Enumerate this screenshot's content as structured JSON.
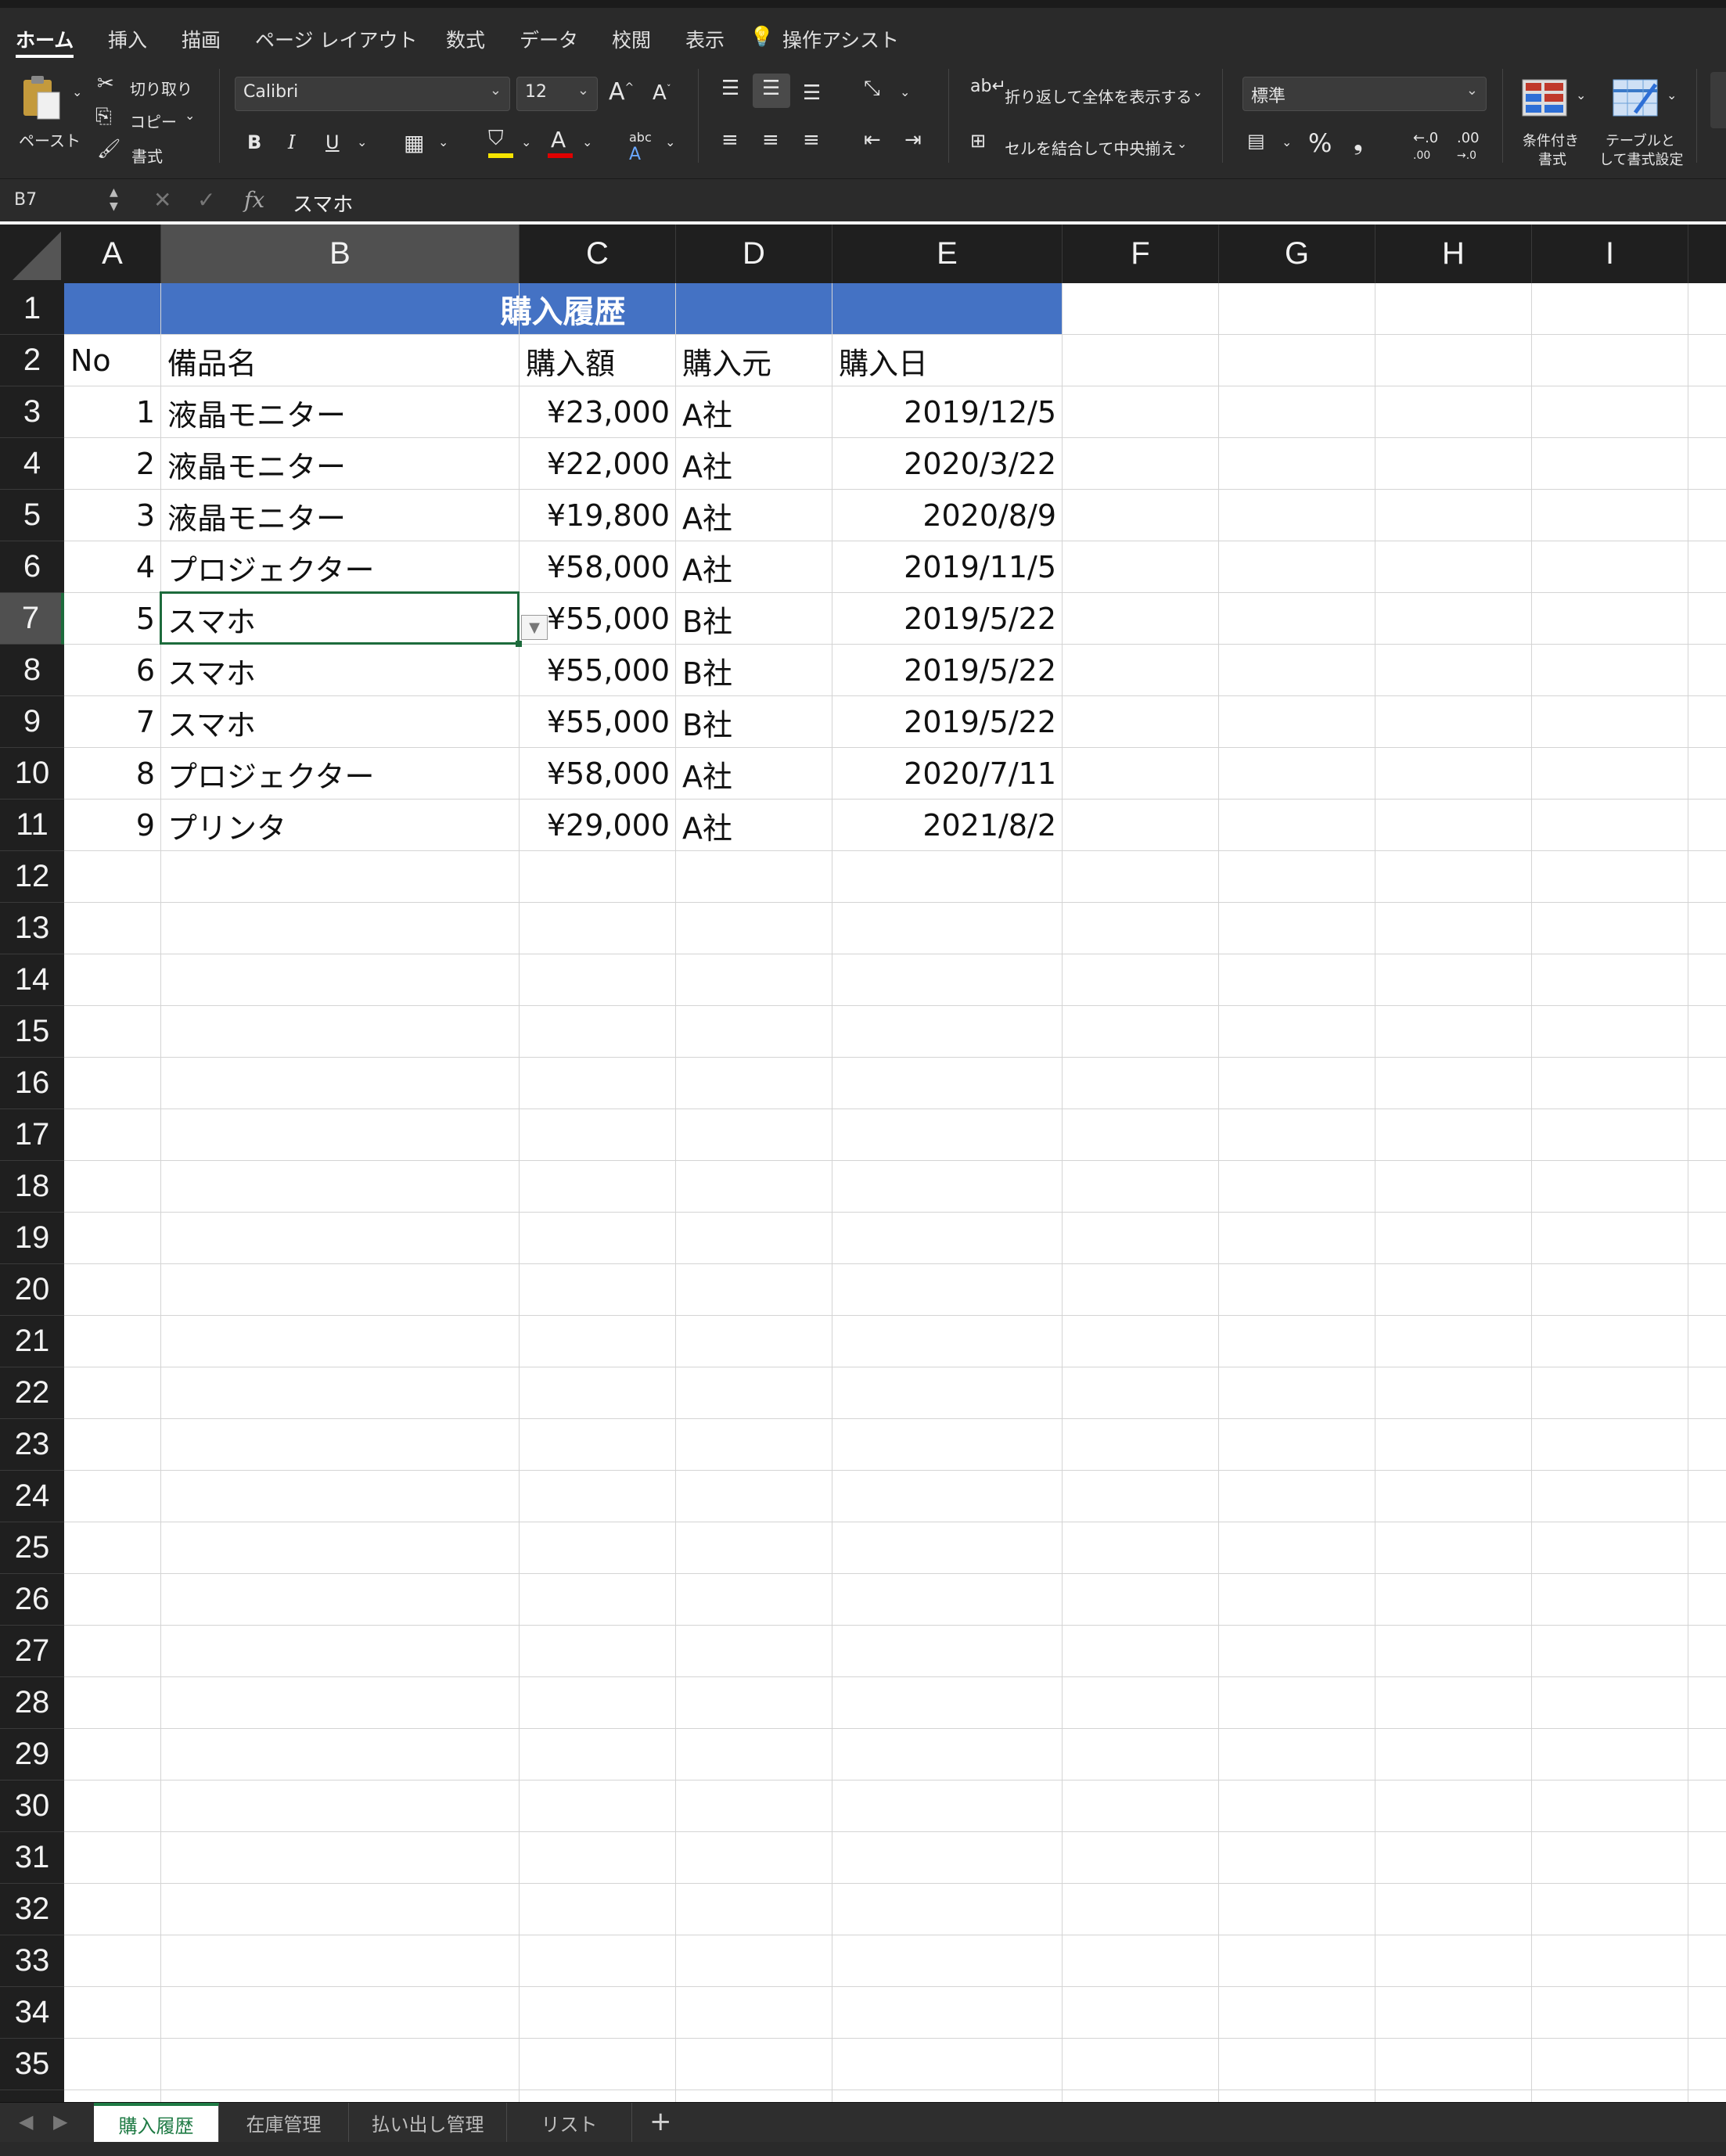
{
  "ribbon": {
    "tabs": [
      "ホーム",
      "挿入",
      "描画",
      "ページ レイアウト",
      "数式",
      "データ",
      "校閲",
      "表示"
    ],
    "assist_label": "操作アシスト",
    "clipboard": {
      "paste": "ペースト",
      "cut": "切り取り",
      "copy": "コピー",
      "format": "書式"
    },
    "font": {
      "name": "Calibri",
      "size": "12",
      "bold": "B",
      "italic": "I",
      "underline": "U",
      "grow": "A",
      "shrink": "A"
    },
    "wrap_label": "折り返して全体を表示する",
    "merge_label": "セルを結合して中央揃え",
    "number_format": "標準",
    "percent": "%",
    "comma": "❟",
    "conditional_label": [
      "条件付き",
      "書式"
    ],
    "table_label": [
      "テーブルと",
      "して書式設定"
    ],
    "colors": {
      "highlight": "#f5e400",
      "font_color": "#e00000",
      "accent": "#1e7a44"
    }
  },
  "formula_bar": {
    "name_box": "B7",
    "value": "スマホ",
    "fx": "fx"
  },
  "columns": [
    "A",
    "B",
    "C",
    "D",
    "E",
    "F",
    "G",
    "H",
    "I"
  ],
  "selected": {
    "column": "B",
    "row": "7"
  },
  "rows": [
    "1",
    "2",
    "3",
    "4",
    "5",
    "6",
    "7",
    "8",
    "9",
    "10",
    "11",
    "12",
    "13",
    "14",
    "15",
    "16",
    "17",
    "18",
    "19",
    "20",
    "21",
    "22",
    "23",
    "24",
    "25",
    "26",
    "27",
    "28",
    "29",
    "30",
    "31",
    "32",
    "33",
    "34",
    "35"
  ],
  "sheet": {
    "title": "購入履歴",
    "headers": [
      "No",
      "備品名",
      "購入額",
      "購入元",
      "購入日"
    ],
    "records": [
      [
        "1",
        "液晶モニター",
        "¥23,000",
        "A社",
        "2019/12/5"
      ],
      [
        "2",
        "液晶モニター",
        "¥22,000",
        "A社",
        "2020/3/22"
      ],
      [
        "3",
        "液晶モニター",
        "¥19,800",
        "A社",
        "2020/8/9"
      ],
      [
        "4",
        "プロジェクター",
        "¥58,000",
        "A社",
        "2019/11/5"
      ],
      [
        "5",
        "スマホ",
        "¥55,000",
        "B社",
        "2019/5/22"
      ],
      [
        "6",
        "スマホ",
        "¥55,000",
        "B社",
        "2019/5/22"
      ],
      [
        "7",
        "スマホ",
        "¥55,000",
        "B社",
        "2019/5/22"
      ],
      [
        "8",
        "プロジェクター",
        "¥58,000",
        "A社",
        "2020/7/11"
      ],
      [
        "9",
        "プリンタ",
        "¥29,000",
        "A社",
        "2021/8/2"
      ]
    ]
  },
  "sheet_tabs": [
    "購入履歴",
    "在庫管理",
    "払い出し管理",
    "リスト"
  ],
  "active_sheet": "購入履歴"
}
